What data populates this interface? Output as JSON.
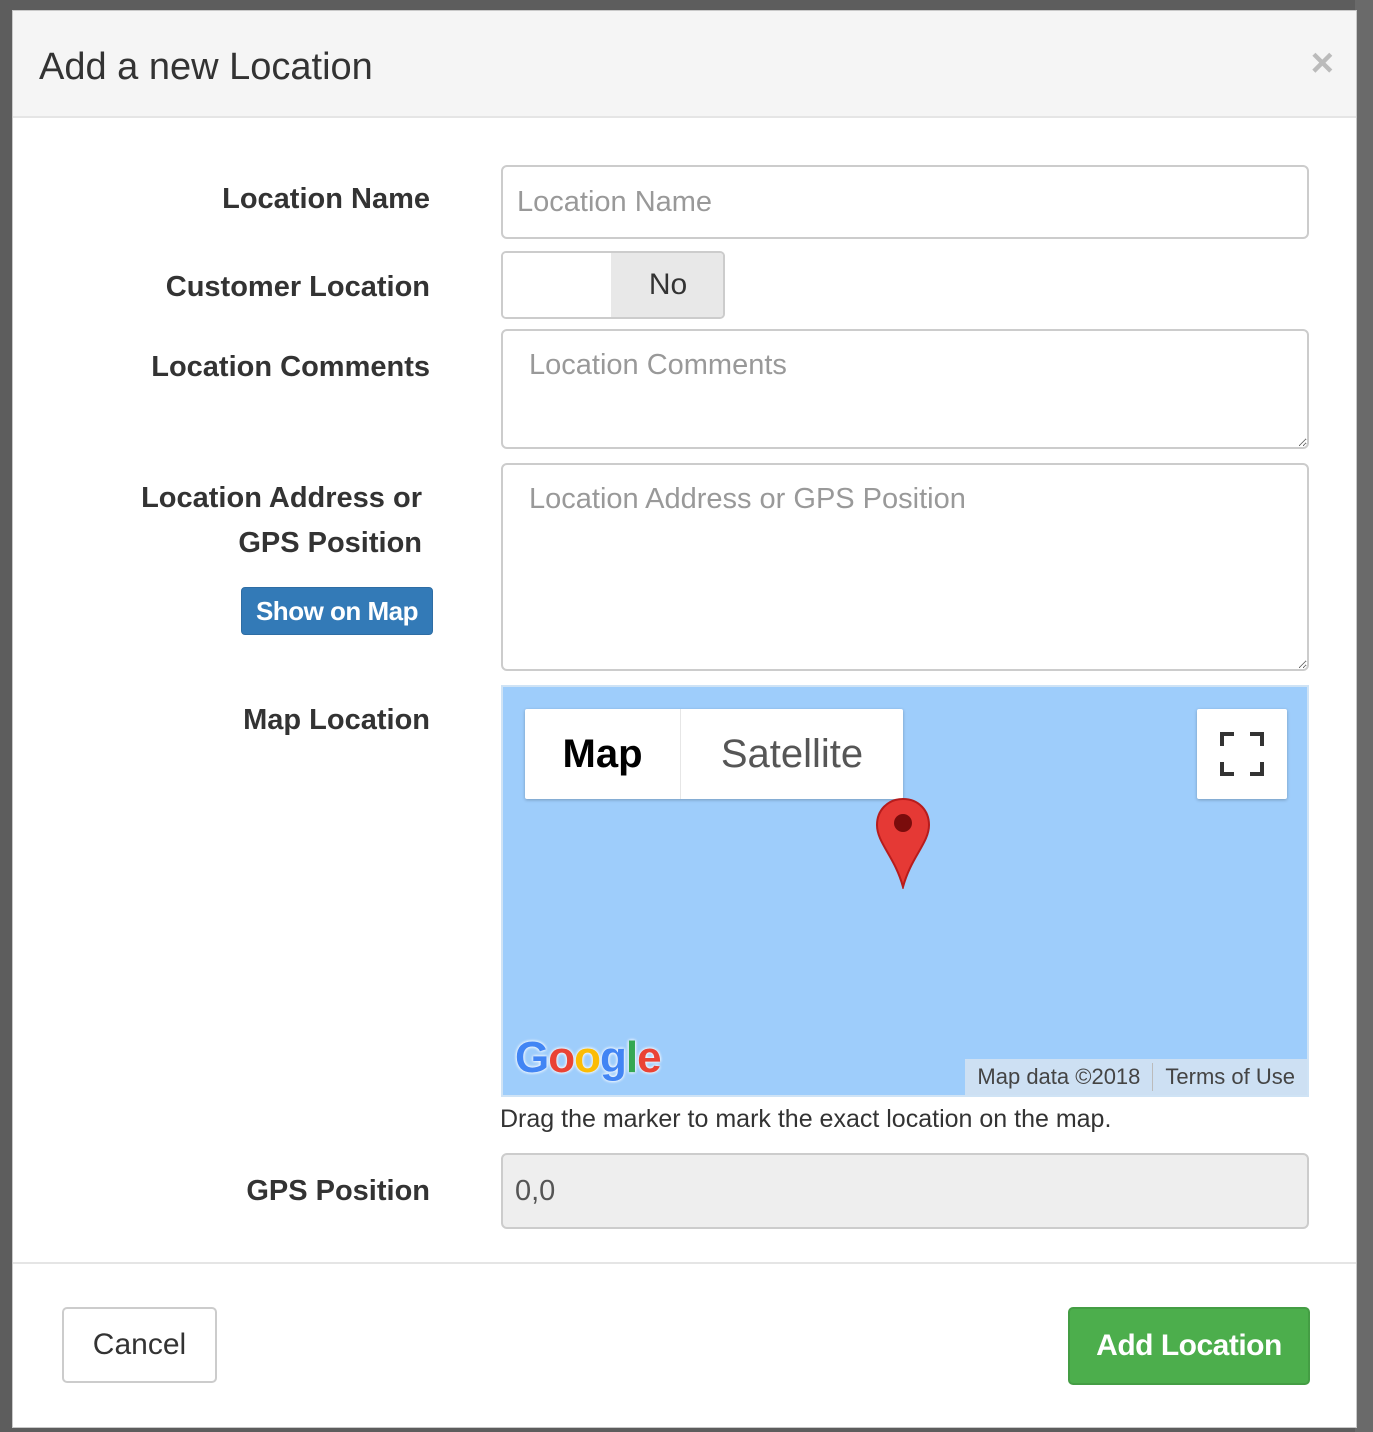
{
  "dialog": {
    "title": "Add a new Location",
    "close_symbol": "×"
  },
  "form": {
    "location_name": {
      "label": "Location Name",
      "placeholder": "Location Name",
      "value": ""
    },
    "customer_location": {
      "label": "Customer Location",
      "state_label": "No"
    },
    "location_comments": {
      "label": "Location Comments",
      "placeholder": "Location Comments",
      "value": ""
    },
    "location_address": {
      "label_line1": "Location Address or",
      "label_line2": "GPS Position",
      "placeholder": "Location Address or GPS Position",
      "value": "",
      "show_on_map_label": "Show on Map"
    },
    "map_location": {
      "label": "Map Location",
      "map_type_options": [
        "Map",
        "Satellite"
      ],
      "selected_map_type": "Map",
      "fullscreen_icon": "fullscreen-icon",
      "marker_icon": "map-marker-icon",
      "logo_text": "Google",
      "attribution": "Map data ©2018",
      "terms_label": "Terms of Use",
      "help_text": "Drag the marker to mark the exact location on the map.",
      "water_color": "#9ecdfb"
    },
    "gps_position": {
      "label": "GPS Position",
      "value": "0,0"
    }
  },
  "footer": {
    "cancel_label": "Cancel",
    "submit_label": "Add Location"
  },
  "colors": {
    "primary": "#337ab7",
    "success": "#4cae4c",
    "marker": "#e53935"
  }
}
